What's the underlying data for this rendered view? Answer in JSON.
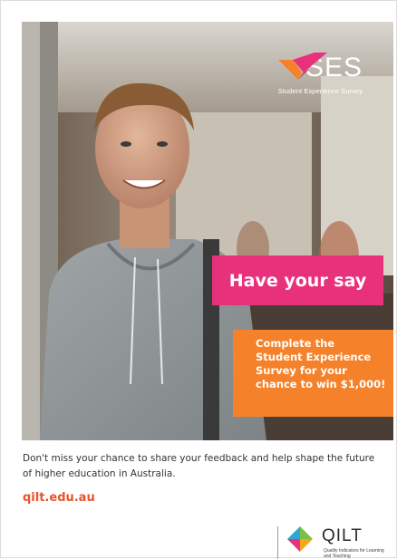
{
  "logo": {
    "text": "SES",
    "subtitle": "Student Experience Survey",
    "icon": "ses-check-mark-icon"
  },
  "headline": "Have your say",
  "offer": "Complete the\nStudent Experience\nSurvey for your\nchance to win $1,000!",
  "body": "Don't miss your chance to share your feedback and help shape the future of higher education in Australia.",
  "url": "qilt.edu.au",
  "qilt": {
    "text": "QILT",
    "subtitle": "Quality Indicators for Learning and Teaching",
    "icon": "qilt-diamond-icon"
  },
  "colors": {
    "pink": "#e8317b",
    "orange": "#f5822a",
    "url": "#e8532b"
  }
}
